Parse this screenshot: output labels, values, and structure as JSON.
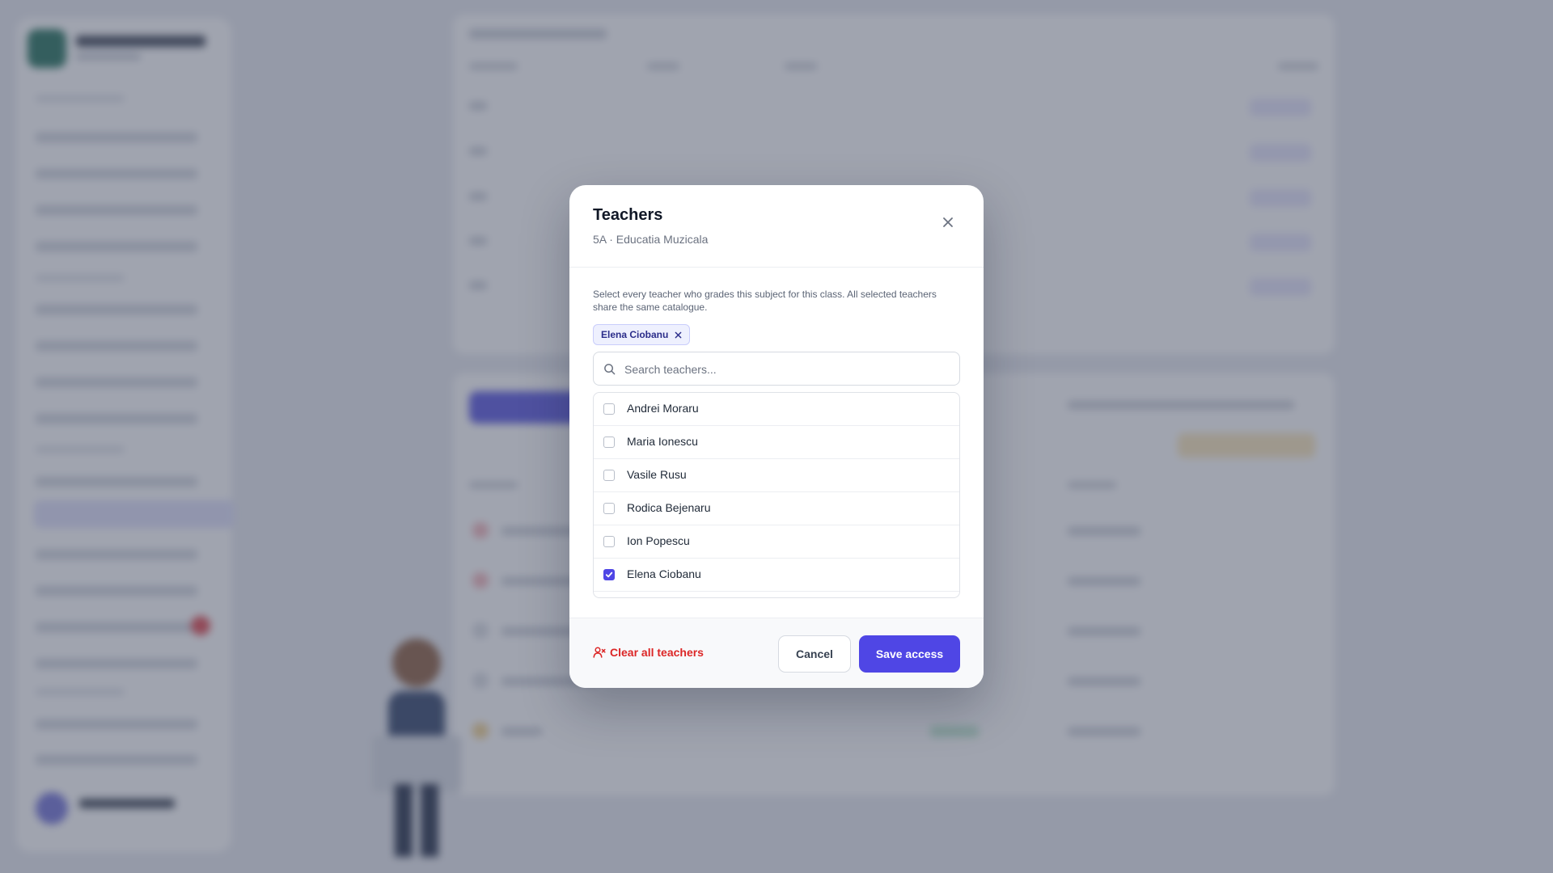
{
  "modal": {
    "title": "Teachers",
    "subtitle": "5A · Educatia Muzicala",
    "description": "Select every teacher who grades this subject for this class. All selected teachers share the same catalogue.",
    "selected_chips": [
      "Elena Ciobanu"
    ],
    "search": {
      "placeholder": "Search teachers...",
      "value": ""
    },
    "teachers": [
      {
        "name": "Andrei Moraru",
        "checked": false
      },
      {
        "name": "Maria Ionescu",
        "checked": false
      },
      {
        "name": "Vasile Rusu",
        "checked": false
      },
      {
        "name": "Rodica Bejenaru",
        "checked": false
      },
      {
        "name": "Ion Popescu",
        "checked": false
      },
      {
        "name": "Elena Ciobanu",
        "checked": true
      }
    ],
    "footer": {
      "clear_label": "Clear all teachers",
      "cancel_label": "Cancel",
      "save_label": "Save access"
    }
  },
  "colors": {
    "accent": "#4f46e5",
    "danger": "#dc2626",
    "overlay": "rgba(72,80,101,0.52)"
  },
  "icons": {
    "close": "close-icon",
    "chip_remove": "x-icon",
    "search": "search-icon",
    "check": "check-icon",
    "clear": "user-x-icon"
  }
}
